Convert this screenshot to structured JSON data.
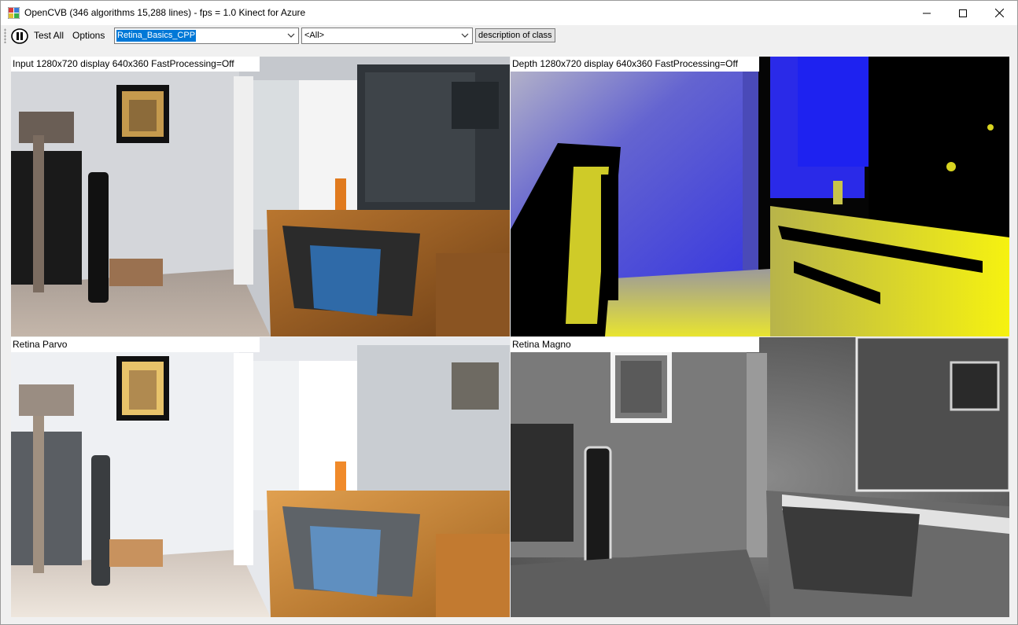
{
  "window": {
    "title": "OpenCVB (346 algorithms 15,288 lines) - fps = 1.0 Kinect for Azure",
    "app_icon": "opencvb-app-icon",
    "controls": [
      "minimize-icon",
      "maximize-icon",
      "close-icon"
    ]
  },
  "toolbar": {
    "pause_icon": "pause-icon",
    "test_all_label": "Test All",
    "options_label": "Options",
    "algorithm_select": "Retina_Basics_CPP",
    "group_select": "<All>",
    "description_button": "description of class"
  },
  "panels": {
    "input_label": "Input 1280x720 display 640x360 FastProcessing=Off",
    "depth_label": "Depth 1280x720 display 640x360 FastProcessing=Off",
    "parvo_label": "Retina Parvo",
    "magno_label": "Retina Magno"
  },
  "colors": {
    "depth_far": "#2a2ee0",
    "depth_near": "#f2ee10",
    "selection": "#0078d7"
  }
}
